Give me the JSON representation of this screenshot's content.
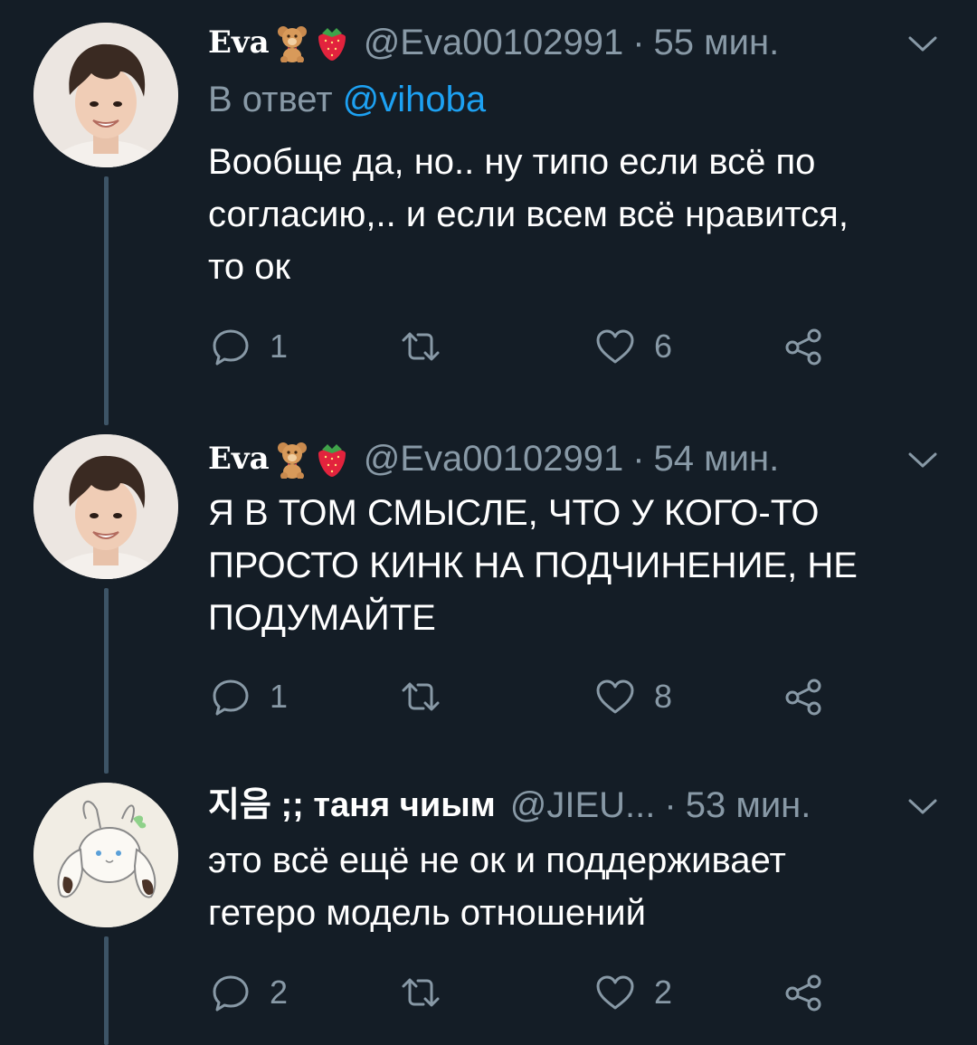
{
  "tweets": [
    {
      "display_name": "Eva",
      "handle": "@Eva00102991",
      "time": "55 мин.",
      "reply_prefix": "В ответ",
      "reply_mention": "@vihoba",
      "text": "Вообще да, но.. ну типо если всё по\nсогласию,.. и если всем всё нравится,\nто ок",
      "replies": "1",
      "retweets": "",
      "likes": "6",
      "emojis": [
        "teddy-bear-icon",
        "strawberry-icon"
      ]
    },
    {
      "display_name": "Eva",
      "handle": "@Eva00102991",
      "time": "54 мин.",
      "text": "Я В ТОМ СМЫСЛЕ, ЧТО У КОГО-ТО\nПРОСТО КИНК НА ПОДЧИНЕНИЕ, НЕ\nПОДУМАЙТЕ",
      "replies": "1",
      "retweets": "",
      "likes": "8",
      "emojis": [
        "teddy-bear-icon",
        "strawberry-icon"
      ]
    },
    {
      "display_name": "지음 ;; таня чиым",
      "handle": "@JIEU...",
      "time": "53 мин.",
      "text": "это всё ещё не ок и поддерживает\nгетеро модель отношений",
      "replies": "2",
      "retweets": "",
      "likes": "2"
    }
  ],
  "separator": "·",
  "colors": {
    "background": "#141d26",
    "secondary_text": "#8899a6",
    "mention": "#1da1f2",
    "thread_line": "#3d5466"
  }
}
